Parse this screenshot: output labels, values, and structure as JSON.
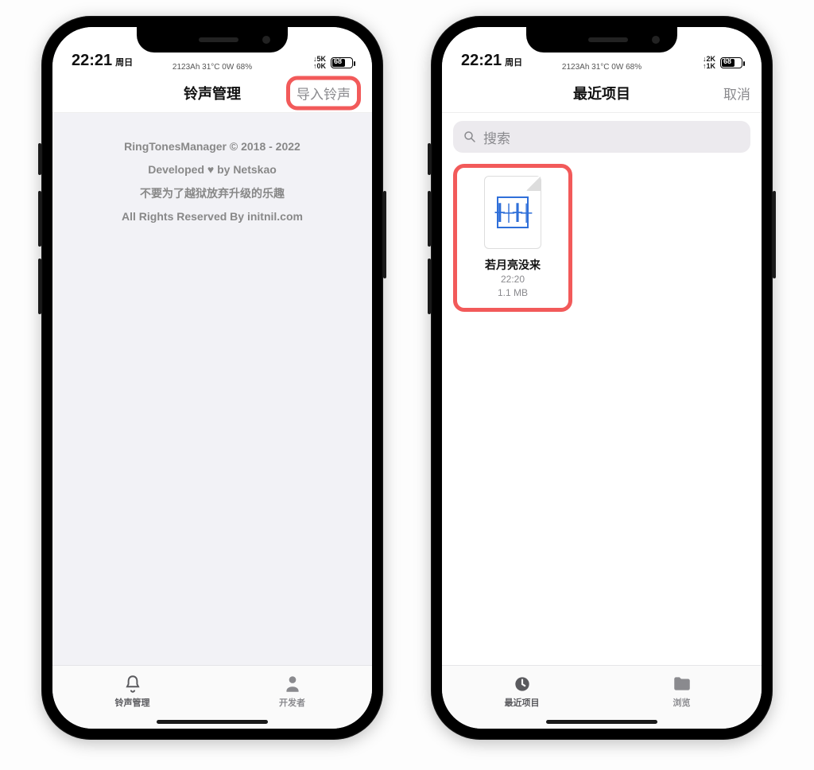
{
  "status": {
    "time": "22:21",
    "day": "周日",
    "sub1": "2123Ah  31°C  0W  68%",
    "sub2": "2123Ah  31°C  0W  68%",
    "net1_top": "↓5K",
    "net1_bot": "↑0K",
    "net2_top": "↓2K",
    "net2_bot": "↑1K",
    "battery_pct": 68,
    "battery_label": "68"
  },
  "phone1": {
    "nav_title": "铃声管理",
    "nav_right": "导入铃声",
    "about_line1": "RingTonesManager © 2018 - 2022",
    "about_line2": "Developed ♥ by Netskao",
    "about_line3": "不要为了越狱放弃升级的乐趣",
    "about_line4": "All Rights Reserved By initnil.com",
    "tab1": "铃声管理",
    "tab2": "开发者"
  },
  "phone2": {
    "nav_title": "最近项目",
    "nav_right": "取消",
    "search_placeholder": "搜索",
    "file_name": "若月亮没来",
    "file_time": "22:20",
    "file_size": "1.1 MB",
    "tab1": "最近项目",
    "tab2": "浏览"
  }
}
